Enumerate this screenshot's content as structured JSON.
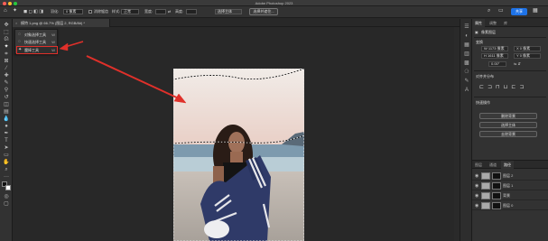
{
  "titlebar": {
    "title": "Adobe Photoshop 2023"
  },
  "options_bar": {
    "feather_label": "羽化:",
    "feather_value": "0 像素",
    "antialias_label": "消除锯齿",
    "style_label": "样式:",
    "style_value": "正常",
    "width_label": "宽度:",
    "height_label": "高度:",
    "select_subject_label": "选择主体",
    "select_mask_label": "选择并遮住...",
    "share_label": "共享"
  },
  "document_tab": {
    "title": "模特 1.png @ 66.7% (图层 2, RGB/8#) *",
    "close": "×"
  },
  "flyout": {
    "items": [
      {
        "icon": "◌",
        "label": "对象选择工具",
        "key": "W",
        "selected": false
      },
      {
        "icon": "◌",
        "label": "快速选择工具",
        "key": "W",
        "selected": false
      },
      {
        "icon": "✦",
        "label": "魔棒工具",
        "key": "W",
        "selected": true
      }
    ]
  },
  "right_panel": {
    "tabs": [
      "属性",
      "调整",
      "库"
    ],
    "pixel_layer_label": "像素图层",
    "transform_label": "变换",
    "w_value": "W 1173 像素",
    "h_value": "H 1611 像素",
    "x_value": "X 0 像素",
    "y_value": "Y 0 像素",
    "angle_value": "0.00°",
    "align_label": "对齐并分布",
    "quick_actions_label": "快速操作",
    "actions": [
      "删除背景",
      "选择主体",
      "去除背景"
    ]
  },
  "layers_panel": {
    "tabs": [
      "图层",
      "通道",
      "路径"
    ],
    "rows": [
      {
        "name": "图层 2"
      },
      {
        "name": "图层 1"
      },
      {
        "name": "背景"
      },
      {
        "name": "图层 0"
      }
    ]
  },
  "colors": {
    "accent_red": "#e0302a",
    "share_blue": "#1e73e8"
  }
}
